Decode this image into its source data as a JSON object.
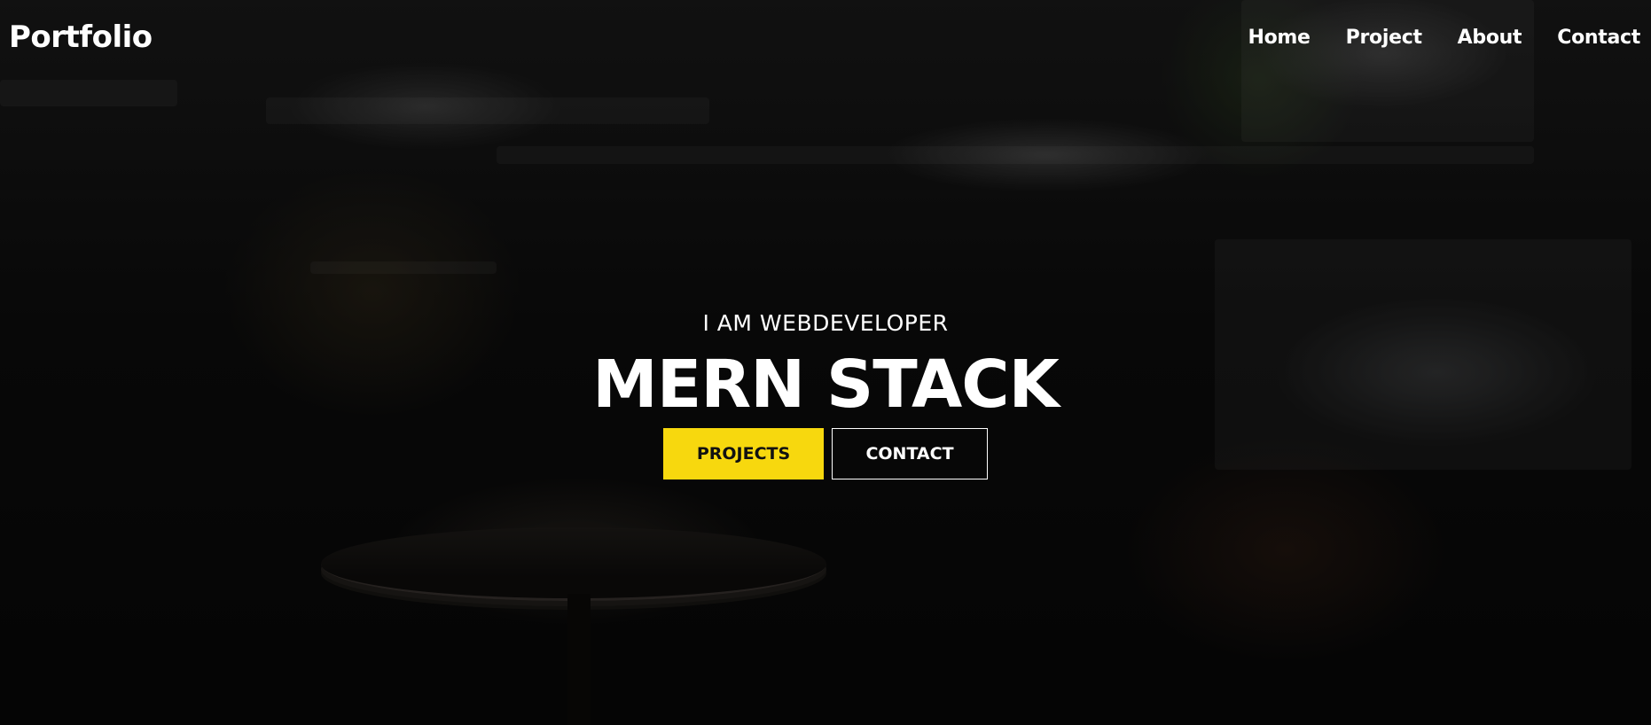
{
  "header": {
    "logo": "Portfolio",
    "nav": [
      {
        "label": "Home"
      },
      {
        "label": "Project"
      },
      {
        "label": "About"
      },
      {
        "label": "Contact"
      }
    ]
  },
  "hero": {
    "subtitle": "I AM WEBDEVELOPER",
    "title": "MERN STACK",
    "primary_button": "PROJECTS",
    "secondary_button": "CONTACT"
  },
  "colors": {
    "accent": "#f7d80e",
    "text": "#ffffff",
    "background": "#0b0b0b"
  }
}
